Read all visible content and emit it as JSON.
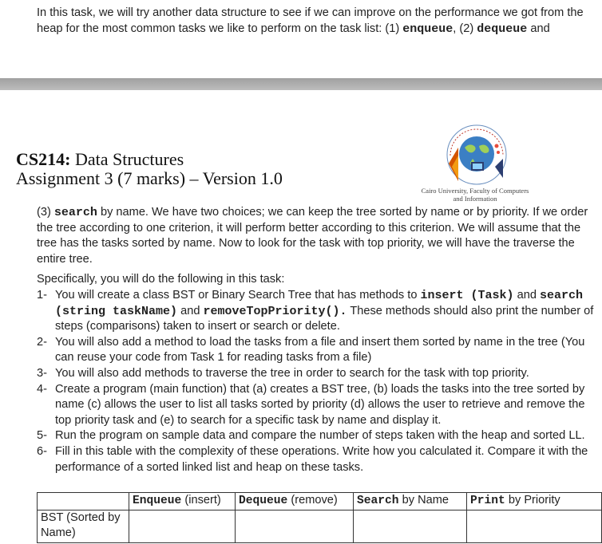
{
  "top_text": {
    "pre": "In this task, we will try another data structure to see if we can improve on the performance we got from the heap for the most common tasks we like to perform on the task list: (1) ",
    "op1": "enqueue",
    "mid": ", (2) ",
    "op2": "dequeue",
    "post": " and"
  },
  "header": {
    "course_code": "CS214:",
    "course_name": " Data Structures",
    "assignment": "Assignment 3 (7 marks) – Version 1.0",
    "university_line1": "Cairo University, Faculty of Computers",
    "university_line2": "and Information"
  },
  "paragraph": {
    "pre": "(3) ",
    "op": "search",
    "post": " by name. We have two choices; we can keep the tree sorted by name or by priority. If we order the tree according to one criterion, it will perform better according to this criterion. We will assume that the tree has the tasks sorted by name. Now to look for the task with top priority, we will have the traverse the entire tree."
  },
  "spec_intro": "Specifically, you will do the following in this task:",
  "items": {
    "n1": "1-",
    "i1_pre": "You will create a class BST or Binary Search Tree that has methods to ",
    "i1_code1": "insert (Task)",
    "i1_and1": " and ",
    "i1_code2": "search (string taskName)",
    "i1_and2": " and ",
    "i1_code3": "removeTopPriority().",
    "i1_post": " These methods should also print the number of steps (comparisons) taken to insert or search or delete.",
    "n2": "2-",
    "i2": "You will also add a method to load the tasks from a file and insert them sorted by name in the tree (You can reuse your code from Task 1 for reading tasks from a file)",
    "n3": "3-",
    "i3": "You will also add methods to traverse the tree in order to search for the task with top priority.",
    "n4": "4-",
    "i4": "Create a program (main function) that (a) creates a BST tree, (b) loads the tasks into the tree sorted by name (c) allows the user to list all tasks sorted by priority (d) allows the user to retrieve and remove the top priority task and (e) to search for a specific task by name and display it.",
    "n5": "5-",
    "i5": "Run the program on sample data and compare the number of steps taken with the heap and sorted LL.",
    "n6": "6-",
    "i6": "Fill in this table with the complexity of these operations. Write how you calculated it. Compare it with the performance of a sorted linked list and heap on these tasks."
  },
  "table": {
    "h1_code": "Enqueue",
    "h1_rest": " (insert)",
    "h2_code": "Dequeue",
    "h2_rest": " (remove)",
    "h3_code": "Search",
    "h3_rest": " by Name",
    "h4_code": "Print",
    "h4_rest": " by Priority",
    "row1_label": "BST (Sorted by Name)"
  }
}
